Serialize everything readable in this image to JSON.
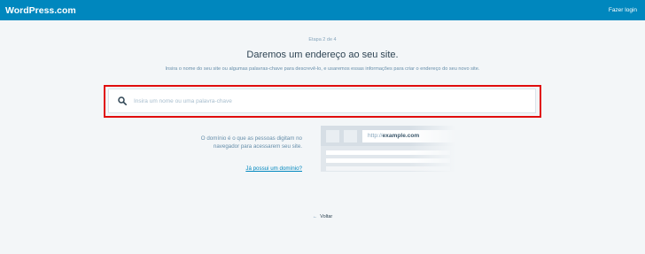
{
  "masterbar": {
    "brand": "WordPress.com",
    "login_label": "Fazer login"
  },
  "step": {
    "progress": "Etapa 2 de 4",
    "current": 2,
    "total": 4
  },
  "header": {
    "title": "Daremos um endereço ao seu site.",
    "subtitle": "Insira o nome do seu site ou algumas palavras-chave para descrevê-lo, e usaremos essas informações para criar o endereço do seu novo site."
  },
  "search": {
    "placeholder": "Insira um nome ou uma palavra-chave",
    "value": ""
  },
  "info": {
    "text": "O domínio é o que as pessoas digitam no navegador para acessarem seu site.",
    "link_label": "Já possui um domínio?",
    "url_prefix": "http://",
    "url_domain": "example.com"
  },
  "footer": {
    "back_label": "Voltar"
  },
  "colors": {
    "masterbar": "#0087be",
    "background": "#f3f6f8",
    "highlight_border": "#e00d0d",
    "link": "#0087be"
  },
  "icons": {
    "search": "search-icon",
    "back": "arrow-left-icon"
  }
}
